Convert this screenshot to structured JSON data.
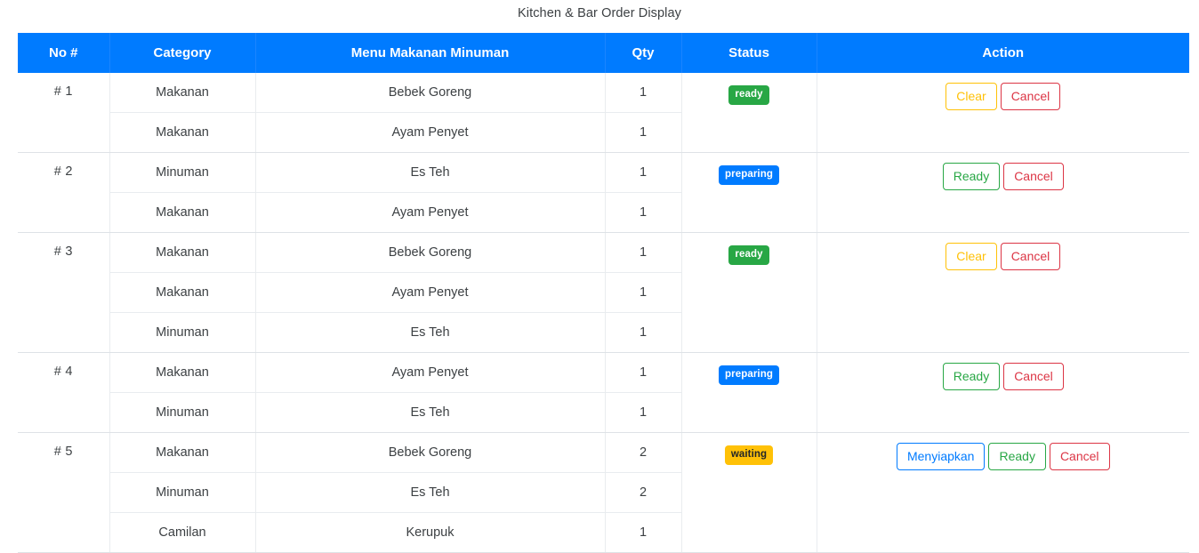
{
  "page": {
    "title": "Kitchen & Bar Order Display"
  },
  "colors": {
    "header_blue": "#007bff",
    "ready_green": "#28a745",
    "preparing_blue": "#007bff",
    "waiting_yellow": "#ffc107",
    "cancel_red": "#dc3545",
    "row_border": "#dee2e6"
  },
  "table": {
    "columns": [
      {
        "key": "no",
        "label": "No #"
      },
      {
        "key": "cat",
        "label": "Category"
      },
      {
        "key": "menu",
        "label": "Menu Makanan Minuman"
      },
      {
        "key": "qty",
        "label": "Qty"
      },
      {
        "key": "status",
        "label": "Status"
      },
      {
        "key": "action",
        "label": "Action"
      }
    ],
    "orders": [
      {
        "no": "# 1",
        "status": {
          "label": "ready",
          "variant": "ready"
        },
        "actions": [
          {
            "label": "Clear",
            "variant": "clear"
          },
          {
            "label": "Cancel",
            "variant": "cancel"
          }
        ],
        "items": [
          {
            "category": "Makanan",
            "menu": "Bebek Goreng",
            "qty": "1"
          },
          {
            "category": "Makanan",
            "menu": "Ayam Penyet",
            "qty": "1"
          }
        ]
      },
      {
        "no": "# 2",
        "status": {
          "label": "preparing",
          "variant": "preparing"
        },
        "actions": [
          {
            "label": "Ready",
            "variant": "ready"
          },
          {
            "label": "Cancel",
            "variant": "cancel"
          }
        ],
        "items": [
          {
            "category": "Minuman",
            "menu": "Es Teh",
            "qty": "1"
          },
          {
            "category": "Makanan",
            "menu": "Ayam Penyet",
            "qty": "1"
          }
        ]
      },
      {
        "no": "# 3",
        "status": {
          "label": "ready",
          "variant": "ready"
        },
        "actions": [
          {
            "label": "Clear",
            "variant": "clear"
          },
          {
            "label": "Cancel",
            "variant": "cancel"
          }
        ],
        "items": [
          {
            "category": "Makanan",
            "menu": "Bebek Goreng",
            "qty": "1"
          },
          {
            "category": "Makanan",
            "menu": "Ayam Penyet",
            "qty": "1"
          },
          {
            "category": "Minuman",
            "menu": "Es Teh",
            "qty": "1"
          }
        ]
      },
      {
        "no": "# 4",
        "status": {
          "label": "preparing",
          "variant": "preparing"
        },
        "actions": [
          {
            "label": "Ready",
            "variant": "ready"
          },
          {
            "label": "Cancel",
            "variant": "cancel"
          }
        ],
        "items": [
          {
            "category": "Makanan",
            "menu": "Ayam Penyet",
            "qty": "1"
          },
          {
            "category": "Minuman",
            "menu": "Es Teh",
            "qty": "1"
          }
        ]
      },
      {
        "no": "# 5",
        "status": {
          "label": "waiting",
          "variant": "waiting"
        },
        "actions": [
          {
            "label": "Menyiapkan",
            "variant": "menyiapkan"
          },
          {
            "label": "Ready",
            "variant": "ready"
          },
          {
            "label": "Cancel",
            "variant": "cancel"
          }
        ],
        "items": [
          {
            "category": "Makanan",
            "menu": "Bebek Goreng",
            "qty": "2"
          },
          {
            "category": "Minuman",
            "menu": "Es Teh",
            "qty": "2"
          },
          {
            "category": "Camilan",
            "menu": "Kerupuk",
            "qty": "1"
          }
        ]
      }
    ]
  }
}
